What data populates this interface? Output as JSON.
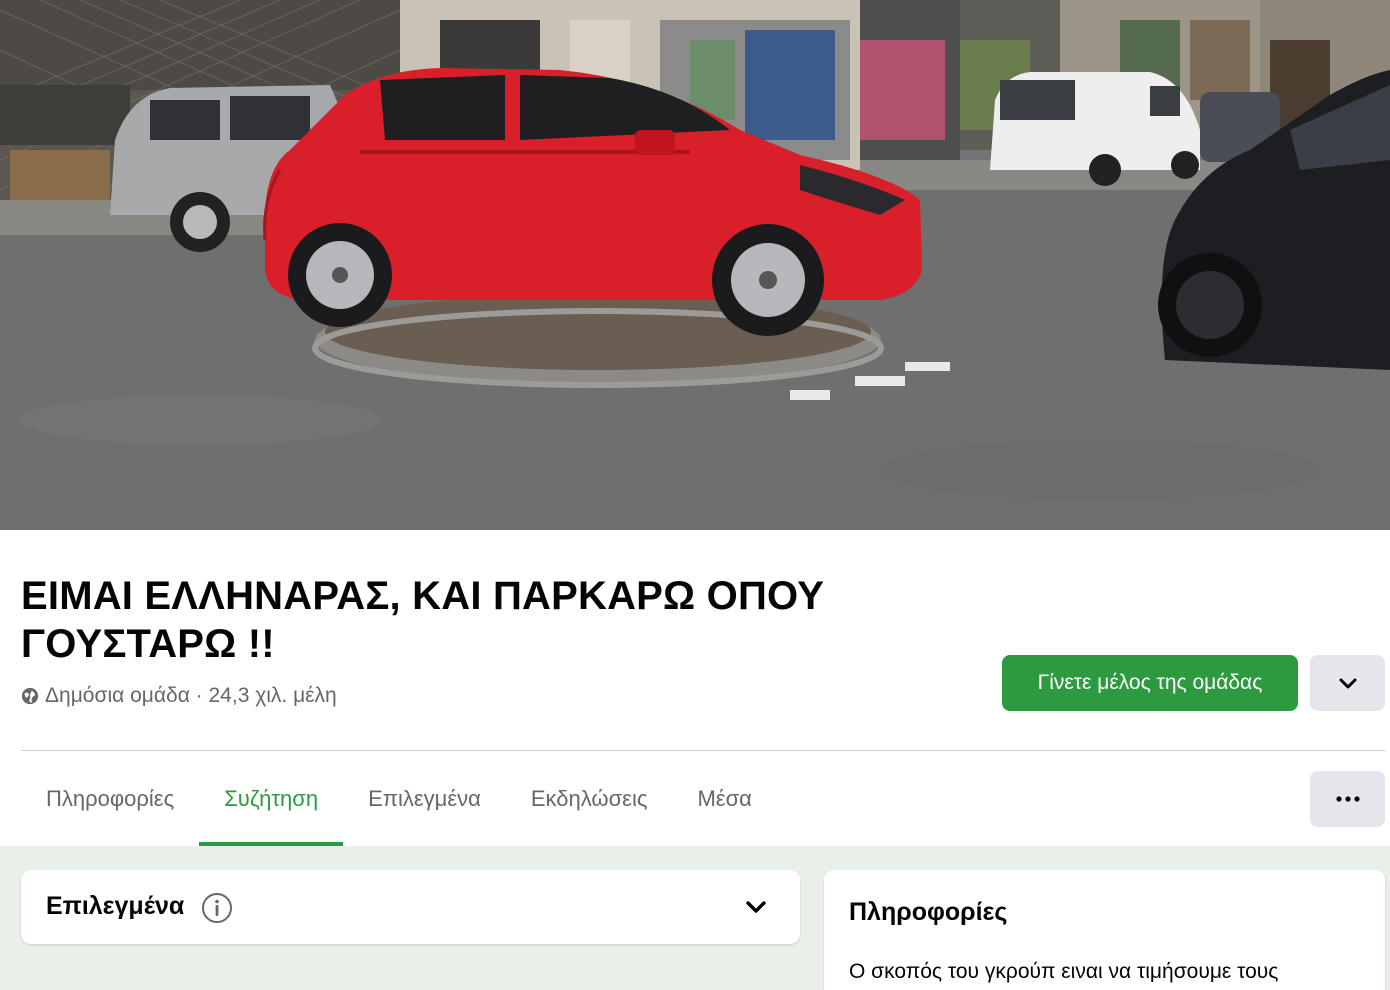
{
  "group": {
    "title": "ΕΙΜΑΙ ΕΛΛΗΝΑΡΑΣ, ΚΑΙ ΠΑΡΚΑΡΩ ΟΠΟΥ ΓΟΥΣΤΑΡΩ !!",
    "meta": "Δημόσια ομάδα · 24,3 χιλ. μέλη",
    "privacy_icon": "globe-icon"
  },
  "actions": {
    "join_label": "Γίνετε μέλος της ομάδας",
    "dropdown_icon": "chevron-down-icon",
    "more_icon": "more-horizontal-icon"
  },
  "tabs": [
    {
      "label": "Πληροφορίες",
      "active": false
    },
    {
      "label": "Συζήτηση",
      "active": true
    },
    {
      "label": "Επιλεγμένα",
      "active": false
    },
    {
      "label": "Εκδηλώσεις",
      "active": false
    },
    {
      "label": "Μέσα",
      "active": false
    }
  ],
  "featured": {
    "label": "Επιλεγμένα",
    "info_icon": "info-icon",
    "toggle_icon": "chevron-down-icon"
  },
  "about": {
    "label": "Πληροφορίες",
    "description": "Ο σκοπός του γκρούπ ειναι να τιμήσουμε τους"
  },
  "colors": {
    "accent": "#2e9a3f",
    "secondary_button": "#e4e6eb",
    "muted_text": "#65676b",
    "content_bg": "#e9efe9"
  }
}
